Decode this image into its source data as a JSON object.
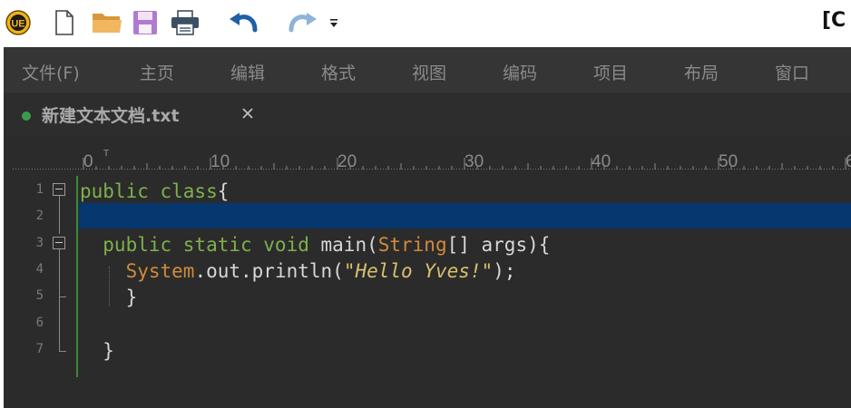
{
  "toolbar": {
    "app_logo_text": "UE",
    "title_fragment": "[C"
  },
  "menu": {
    "items": [
      "文件(F)",
      "主页",
      "编辑",
      "格式",
      "视图",
      "编码",
      "项目",
      "布局",
      "窗口"
    ]
  },
  "tab": {
    "label": "新建文本文档.txt",
    "close_symbol": "×",
    "status_color": "#3a9b4f"
  },
  "ruler": {
    "labels": [
      "0",
      "10",
      "20",
      "30",
      "40",
      "50",
      "6"
    ]
  },
  "editor": {
    "current_line": 2,
    "line_numbers": [
      "1",
      "2",
      "3",
      "4",
      "5",
      "6",
      "7"
    ],
    "lines": [
      {
        "tokens": [
          {
            "t": "public class",
            "c": "kw"
          },
          {
            "t": "{",
            "c": "punc"
          }
        ]
      },
      {
        "tokens": []
      },
      {
        "tokens": [
          {
            "t": "  public static void ",
            "c": "kw"
          },
          {
            "t": "main(",
            "c": "punc"
          },
          {
            "t": "String",
            "c": "type"
          },
          {
            "t": "[] args){",
            "c": "punc"
          }
        ]
      },
      {
        "tokens": [
          {
            "t": "    ",
            "c": "punc"
          },
          {
            "t": "System",
            "c": "type"
          },
          {
            "t": ".out.println(",
            "c": "punc"
          },
          {
            "t": "\"Hello Yves!\"",
            "c": "str"
          },
          {
            "t": ");",
            "c": "punc"
          }
        ]
      },
      {
        "tokens": [
          {
            "t": "    }",
            "c": "punc"
          }
        ]
      },
      {
        "tokens": []
      },
      {
        "tokens": [
          {
            "t": "  }",
            "c": "punc"
          }
        ]
      }
    ]
  },
  "colors": {
    "keyword": "#7db14c",
    "type": "#d08a3c",
    "string": "#d8c070",
    "selection": "#06376f"
  }
}
